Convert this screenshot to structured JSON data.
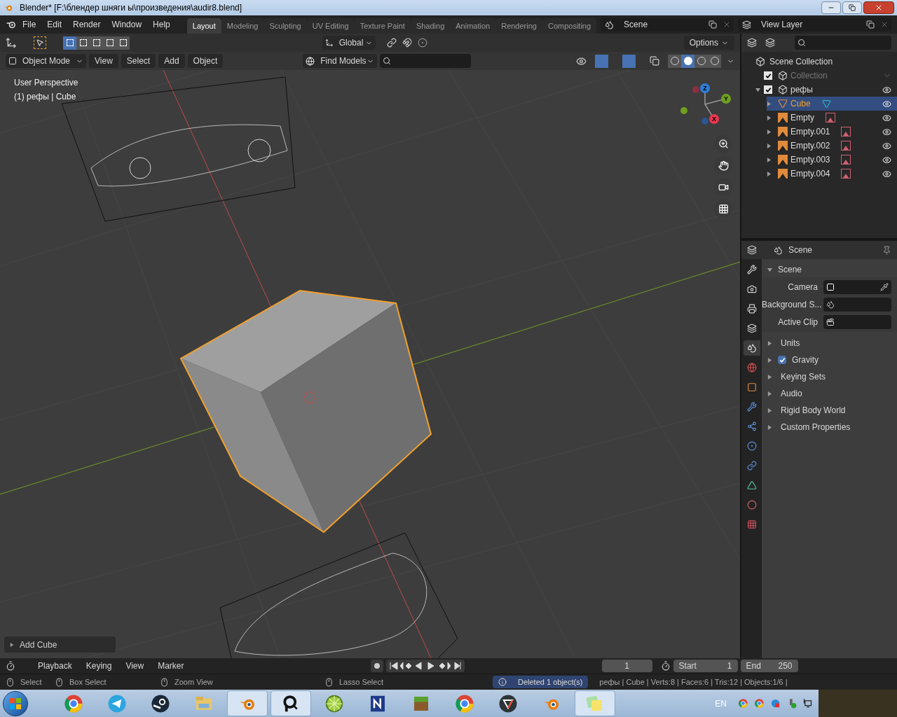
{
  "window": {
    "title": "Blender* [F:\\блендер шняги ы\\произведения\\audir8.blend]"
  },
  "menu": [
    "File",
    "Edit",
    "Render",
    "Window",
    "Help"
  ],
  "workspace_tabs": [
    {
      "label": "Layout",
      "selected": true
    },
    {
      "label": "Modeling",
      "selected": false
    },
    {
      "label": "Sculpting",
      "selected": false
    },
    {
      "label": "UV Editing",
      "selected": false
    },
    {
      "label": "Texture Paint",
      "selected": false
    },
    {
      "label": "Shading",
      "selected": false
    },
    {
      "label": "Animation",
      "selected": false
    },
    {
      "label": "Rendering",
      "selected": false
    },
    {
      "label": "Compositing",
      "selected": false
    }
  ],
  "scene": {
    "name": "Scene"
  },
  "view_layer": {
    "name": "View Layer"
  },
  "tool_header": {
    "select_modes": [
      {
        "selected": true
      },
      {
        "selected": false
      },
      {
        "selected": false
      },
      {
        "selected": false
      },
      {
        "selected": false
      }
    ],
    "orientation": "Global",
    "options": "Options"
  },
  "view_header": {
    "mode": "Object Mode",
    "menus": [
      "View",
      "Select",
      "Add",
      "Object"
    ],
    "find": "Find Models",
    "shading_modes": [
      {
        "selected": false
      },
      {
        "selected": true
      },
      {
        "selected": false
      },
      {
        "selected": false
      }
    ]
  },
  "viewport": {
    "overlay_lines": [
      "User Perspective",
      "(1) рефы | Cube"
    ],
    "gizmo_axes": [
      {
        "label": "Z",
        "color": "#2f7dd8"
      },
      {
        "label": "Y",
        "color": "#6ea020"
      },
      {
        "label": "X",
        "color": "#e8364f"
      }
    ],
    "last_operator": "Add Cube"
  },
  "outliner": {
    "root": "Scene Collection",
    "children": [
      {
        "name": "Collection",
        "kind": "collection",
        "checked": true,
        "disabled": true,
        "selected": false
      },
      {
        "name": "рефы",
        "kind": "collection",
        "checked": true,
        "disabled": false,
        "selected": false,
        "expanded": true,
        "children": [
          {
            "name": "Cube",
            "kind": "mesh",
            "selected": true,
            "expanded": false
          },
          {
            "name": "Empty",
            "kind": "empty",
            "selected": false,
            "expanded": false
          },
          {
            "name": "Empty.001",
            "kind": "empty",
            "selected": false,
            "expanded": false
          },
          {
            "name": "Empty.002",
            "kind": "empty",
            "selected": false,
            "expanded": false
          },
          {
            "name": "Empty.003",
            "kind": "empty",
            "selected": false,
            "expanded": false
          },
          {
            "name": "Empty.004",
            "kind": "empty",
            "selected": false,
            "expanded": false
          }
        ]
      }
    ]
  },
  "properties": {
    "context": "Scene",
    "tabs": [
      {
        "kind": "tool",
        "selected": false
      },
      {
        "kind": "render",
        "selected": false
      },
      {
        "kind": "output",
        "selected": false
      },
      {
        "kind": "view_layer",
        "selected": false
      },
      {
        "kind": "scene",
        "selected": true
      },
      {
        "kind": "world",
        "selected": false
      },
      {
        "kind": "object",
        "selected": false
      },
      {
        "kind": "modifiers",
        "selected": false
      },
      {
        "kind": "particles",
        "selected": false
      },
      {
        "kind": "physics",
        "selected": false
      },
      {
        "kind": "constraints",
        "selected": false
      },
      {
        "kind": "data",
        "selected": false
      },
      {
        "kind": "material",
        "selected": false
      },
      {
        "kind": "texture",
        "selected": false
      }
    ],
    "panel": {
      "title": "Scene",
      "expanded": true,
      "fields": [
        {
          "label": "Camera",
          "kind": "camera"
        },
        {
          "label": "Background S...",
          "kind": "scene"
        },
        {
          "label": "Active Clip",
          "kind": "clip"
        }
      ]
    },
    "subpanels": [
      {
        "title": "Units",
        "kind": "plain",
        "expanded": false
      },
      {
        "title": "Gravity",
        "kind": "checkbox",
        "checked": true,
        "expanded": false
      },
      {
        "title": "Keying Sets",
        "kind": "plain",
        "expanded": false
      },
      {
        "title": "Audio",
        "kind": "plain",
        "expanded": false
      },
      {
        "title": "Rigid Body World",
        "kind": "plain",
        "expanded": false
      },
      {
        "title": "Custom Properties",
        "kind": "plain",
        "expanded": false
      }
    ]
  },
  "timeline": {
    "menus": [
      "Playback",
      "Keying",
      "View",
      "Marker"
    ],
    "current_frame": "1",
    "start_label": "Start",
    "start": "1",
    "end_label": "End",
    "end": "250"
  },
  "status_bar": {
    "hints": [
      "Select",
      "Box Select",
      "Zoom View",
      "Lasso Select"
    ],
    "report": "Deleted 1 object(s)",
    "stats": "рефы | Cube | Verts:8 | Faces:6 | Tris:12 | Objects:1/6 |"
  },
  "taskbar": {
    "apps": [
      {
        "kind": "chrome",
        "selected": false
      },
      {
        "kind": "telegram",
        "selected": false
      },
      {
        "kind": "steam",
        "selected": false
      },
      {
        "kind": "folder",
        "selected": false
      },
      {
        "kind": "blender",
        "selected": true
      },
      {
        "kind": "search",
        "selected": true
      },
      {
        "kind": "lime",
        "selected": false
      },
      {
        "kind": "letter",
        "selected": false
      },
      {
        "kind": "block",
        "selected": false
      },
      {
        "kind": "chrome",
        "selected": false
      },
      {
        "kind": "vector",
        "selected": false
      },
      {
        "kind": "blender",
        "selected": false
      },
      {
        "kind": "notes",
        "selected": true
      }
    ],
    "language": "EN"
  }
}
